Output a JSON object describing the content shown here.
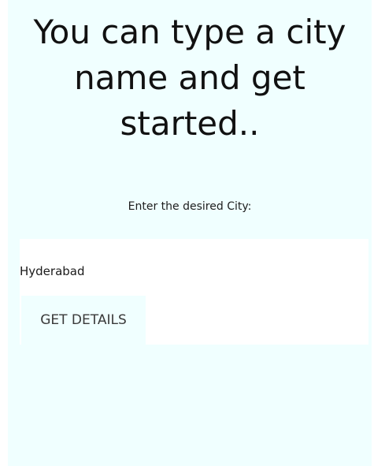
{
  "headline": "You can type a city name and get started..",
  "prompt_label": "Enter the desired City:",
  "city_input": {
    "value": "Hyderabad",
    "placeholder": ""
  },
  "get_details_label": "GET DETAILS",
  "colors": {
    "screen_background": "#f0ffff",
    "card_background": "#ffffff",
    "headline_text": "#111111",
    "button_text": "#3a3a3a"
  }
}
